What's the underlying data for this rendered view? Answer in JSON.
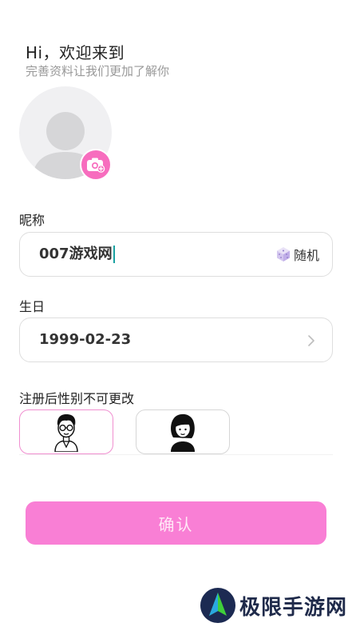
{
  "header": {
    "greeting": "Hi，欢迎来到",
    "subtitle": "完善资料让我们更加了解你"
  },
  "avatar": {
    "icon": "default-avatar-icon",
    "upload_icon": "camera-add-icon"
  },
  "nickname": {
    "label": "昵称",
    "value": "007游戏网",
    "random_label": "随机",
    "random_icon": "dice-icon"
  },
  "birthday": {
    "label": "生日",
    "value": "1999-02-23",
    "icon": "chevron-right-icon"
  },
  "gender": {
    "label": "注册后性别不可更改",
    "options": [
      {
        "icon": "male-avatar-icon",
        "selected": true
      },
      {
        "icon": "female-avatar-icon",
        "selected": false
      }
    ]
  },
  "confirm": {
    "label": "确认"
  },
  "watermark": {
    "text": "极限手游网"
  },
  "colors": {
    "accent": "#f97fd5",
    "camera": "#f76dbe",
    "selected_border": "#f08fd0",
    "caret": "#1aa1a1"
  }
}
